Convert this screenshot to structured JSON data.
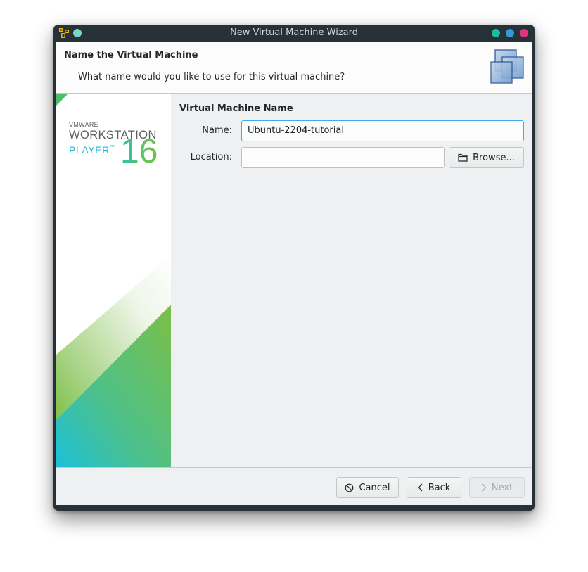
{
  "window": {
    "title": "New Virtual Machine Wizard",
    "app_icon": "vmware-player-icon",
    "controls": [
      {
        "name": "minimize-button",
        "color": "#1abc9c"
      },
      {
        "name": "maximize-button",
        "color": "#3498db"
      },
      {
        "name": "close-button",
        "color": "#e0357a"
      }
    ],
    "pin_dot_color": "#7fd4c8"
  },
  "header": {
    "title": "Name the Virtual Machine",
    "subtitle": "What name would you like to use for this virtual machine?",
    "icon": "virtual-machines-icon"
  },
  "banner": {
    "vendor": "VMWARE",
    "product": "WORKSTATION",
    "edition": "PLAYER",
    "trademark": "™",
    "version": "16"
  },
  "form": {
    "section_title": "Virtual Machine Name",
    "name_label": "Name:",
    "name_value": "Ubuntu-2204-tutorial",
    "location_label": "Location:",
    "location_value": "",
    "browse_label": "Browse..."
  },
  "footer": {
    "cancel_label": "Cancel",
    "back_label": "Back",
    "next_label": "Next",
    "next_enabled": false
  },
  "colors": {
    "focus_accent": "#3daee9",
    "titlebar": "#263238",
    "brand_green": "#78be43",
    "brand_teal": "#1fbcd6"
  }
}
